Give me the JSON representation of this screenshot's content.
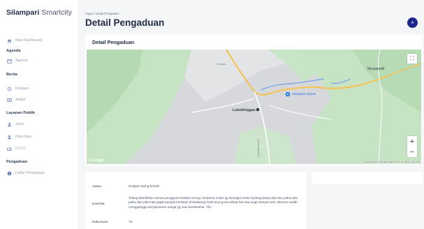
{
  "app": {
    "brand_bold": "Silampari",
    "brand_light": "Smartcity"
  },
  "sidebar": {
    "dashboard": "Main Dashboard",
    "sections": [
      {
        "title": "Agenda",
        "items": [
          {
            "label": "Agenda",
            "icon": "calendar-icon"
          }
        ]
      },
      {
        "title": "Berita",
        "items": [
          {
            "label": "Kategori",
            "icon": "tag-icon"
          },
          {
            "label": "Artikel",
            "icon": "article-icon"
          }
        ]
      },
      {
        "title": "Layanan Publik",
        "items": [
          {
            "label": "Jenis",
            "icon": "person-icon"
          },
          {
            "label": "Peta Data",
            "icon": "person-icon"
          },
          {
            "label": "CCTV",
            "icon": "camera-icon"
          }
        ]
      },
      {
        "title": "Pengaduan",
        "items": [
          {
            "label": "Daftar Pengaduan",
            "icon": "info-icon"
          }
        ]
      }
    ]
  },
  "header": {
    "breadcrumb": "Pages / Detail Pengaduan",
    "title": "Detail Pengaduan",
    "avatar_initial": "A"
  },
  "map_card": {
    "title": "Detail Pengaduan",
    "labels": {
      "airport": "Silampari Airport",
      "city": "Lubuklinggau",
      "east": "Muarabeliti",
      "road_top": "Jl. Lintas",
      "road_vertical": "SOUTH SUMATRA"
    },
    "attribution": "Keyboard shortcuts   Map data ©2022   Terms of Use   Report a map error",
    "google": "Google",
    "zoom_in": "+",
    "zoom_out": "−",
    "fullscreen": "⛶"
  },
  "detail": {
    "rows": [
      {
        "key": "JUDUL",
        "value": "Knalpot racing berisik"
      },
      {
        "key": "KONTEN",
        "value": "Tolong ditertibkan semua pengguna knalpot racing, terutama motor yg dicurigai motor bodong tanpa plat dan pakai plat palsu dan plat mati pajak banyak melintas di bidakang hotel arya guna setiap hari dan pagi sampai sore. Bener2 sudah mengganggu kenyamanan warga yg mau beristirahat. Thx"
      },
      {
        "key": "PUBLIKASI",
        "value": "Ya"
      }
    ]
  },
  "colors": {
    "primary": "#1e2a8a",
    "map_urban": "#d4d7da",
    "map_green": "#c6e3c4",
    "road": "#f2c45a",
    "water": "#7aa7e6"
  }
}
